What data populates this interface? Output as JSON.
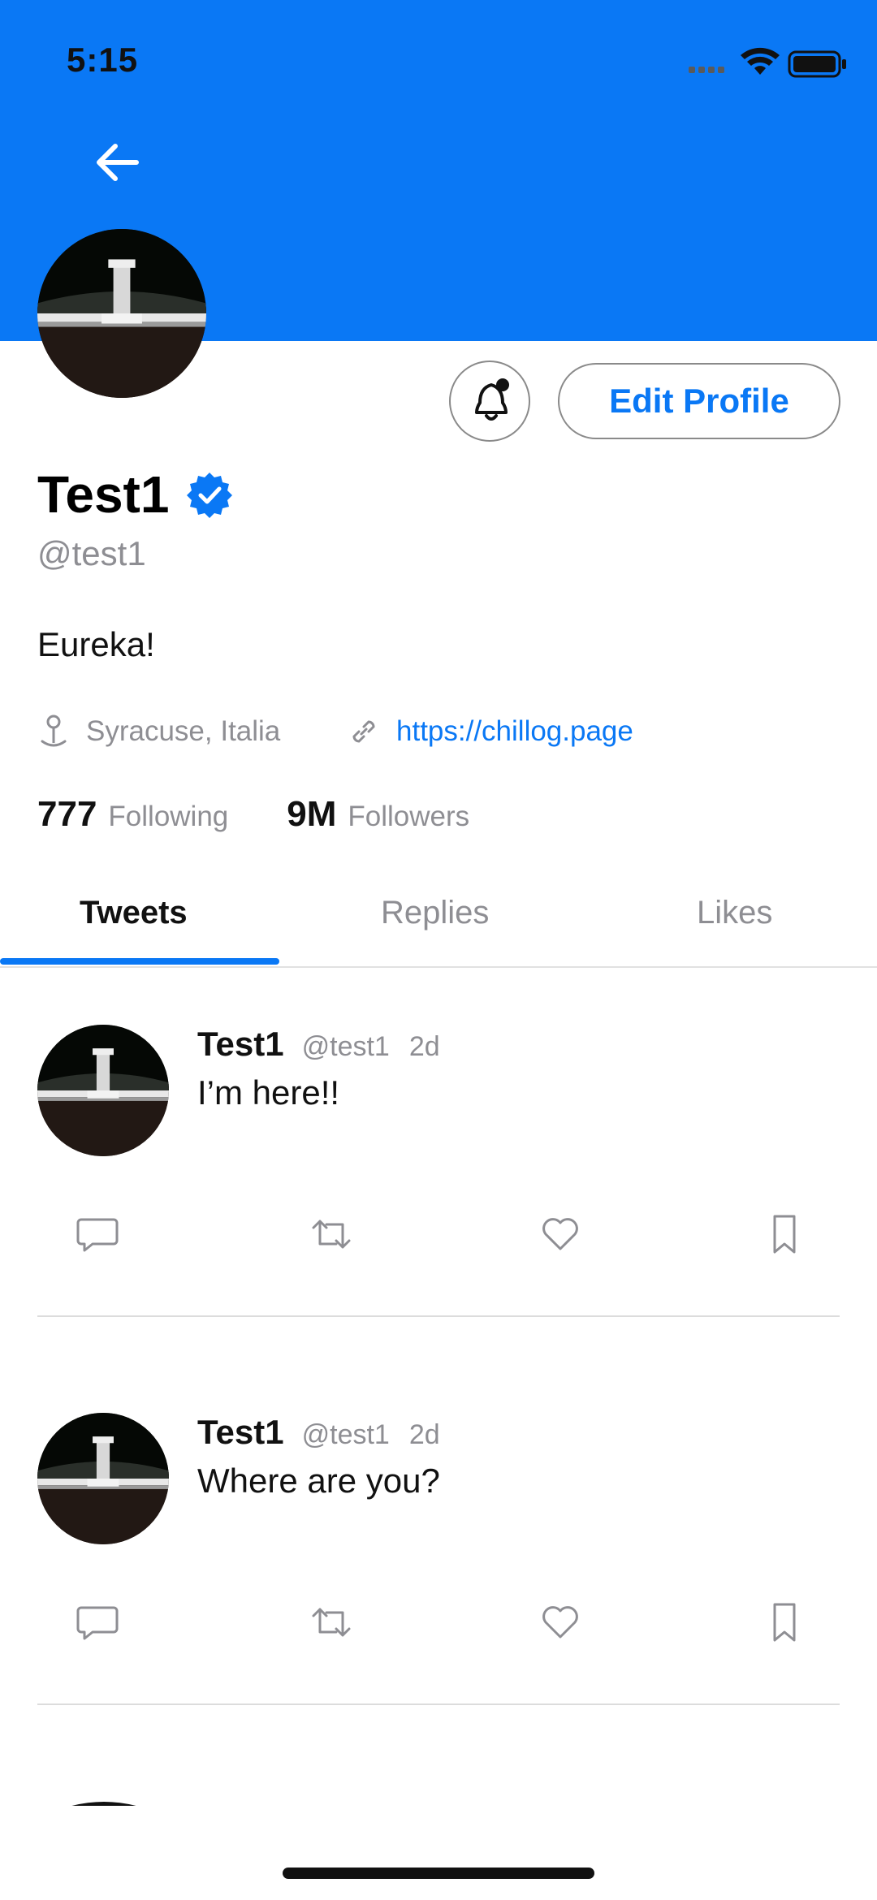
{
  "status_bar": {
    "time": "5:15"
  },
  "profile": {
    "name": "Test1",
    "handle": "@test1",
    "bio": "Eureka!",
    "location": "Syracuse, Italia",
    "website": "https://chillog.page",
    "following_count": "777",
    "following_label": "Following",
    "followers_count": "9M",
    "followers_label": "Followers",
    "edit_button": "Edit Profile"
  },
  "tabs": [
    {
      "label": "Tweets",
      "active": true
    },
    {
      "label": "Replies",
      "active": false
    },
    {
      "label": "Likes",
      "active": false
    }
  ],
  "tweets": [
    {
      "name": "Test1",
      "handle": "@test1",
      "time": "2d",
      "text": "I’m here!!"
    },
    {
      "name": "Test1",
      "handle": "@test1",
      "time": "2d",
      "text": "Where are you?"
    }
  ],
  "colors": {
    "accent": "#0a78f5",
    "muted": "#8e8e93"
  },
  "icons": {
    "back": "arrow-left-icon",
    "notify": "bell-icon",
    "verified": "verified-badge-icon",
    "location": "pin-icon",
    "link": "link-icon",
    "reply": "comment-icon",
    "retweet": "retweet-icon",
    "like": "heart-icon",
    "bookmark": "bookmark-icon"
  }
}
